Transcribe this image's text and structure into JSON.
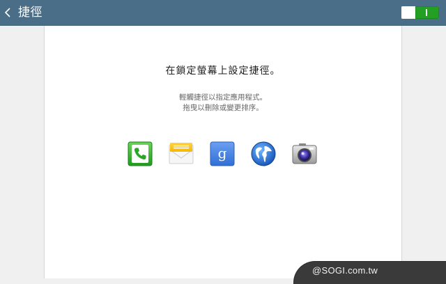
{
  "header": {
    "title": "捷徑",
    "back_icon": "chevron-left-icon",
    "switch_state": "on",
    "accent_color": "#4a6e87",
    "switch_color": "#23a023"
  },
  "content": {
    "headline": "在鎖定螢幕上設定捷徑。",
    "description_line1": "輕觸捷徑以指定應用程式。",
    "description_line2": "拖曳以刪除或變更排序。"
  },
  "shortcuts": [
    {
      "icon": "phone-icon"
    },
    {
      "icon": "message-icon"
    },
    {
      "icon": "google-search-icon"
    },
    {
      "icon": "browser-globe-icon"
    },
    {
      "icon": "camera-icon"
    }
  ],
  "watermark": {
    "text": "@SOGI.com.tw"
  }
}
